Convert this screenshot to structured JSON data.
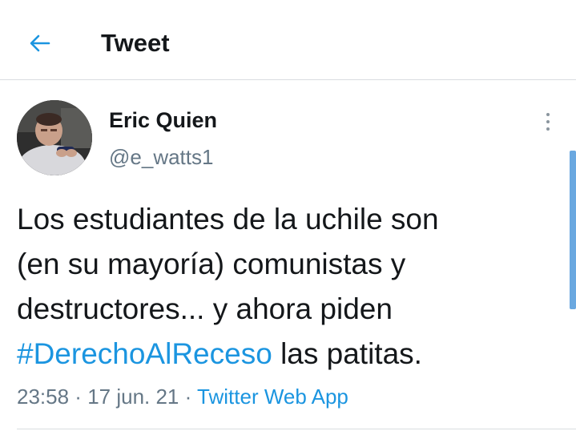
{
  "header": {
    "title": "Tweet",
    "back_icon": "arrow-left-icon"
  },
  "tweet": {
    "author": {
      "name": "Eric Quien",
      "handle": "@e_watts1"
    },
    "text_lines": [
      "Los estudiantes de la uchile son",
      "(en su mayoría) comunistas y",
      "destructores... y ahora piden"
    ],
    "hashtag": "#DerechoAlReceso",
    "text_after_hashtag": " las patitas.",
    "time": "23:58",
    "date": "17 jun. 21",
    "separator": " · ",
    "source": "Twitter Web App",
    "more_icon": "more-vertical-icon"
  },
  "colors": {
    "accent": "#1b95e0",
    "secondary_text": "#657786",
    "primary_text": "#14171a",
    "divider": "#d9dde0"
  }
}
